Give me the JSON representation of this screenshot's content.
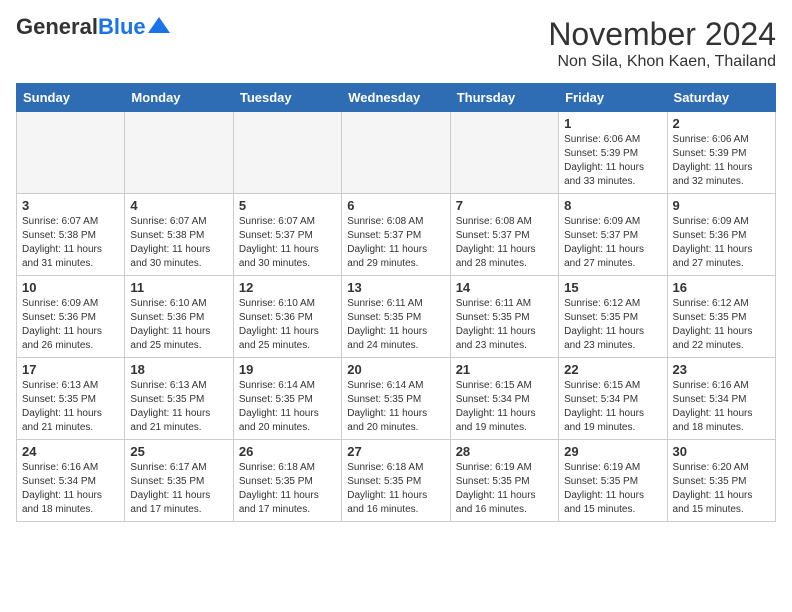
{
  "header": {
    "logo_general": "General",
    "logo_blue": "Blue",
    "month_title": "November 2024",
    "location": "Non Sila, Khon Kaen, Thailand"
  },
  "days_of_week": [
    "Sunday",
    "Monday",
    "Tuesday",
    "Wednesday",
    "Thursday",
    "Friday",
    "Saturday"
  ],
  "weeks": [
    [
      {
        "day": "",
        "info": ""
      },
      {
        "day": "",
        "info": ""
      },
      {
        "day": "",
        "info": ""
      },
      {
        "day": "",
        "info": ""
      },
      {
        "day": "",
        "info": ""
      },
      {
        "day": "1",
        "info": "Sunrise: 6:06 AM\nSunset: 5:39 PM\nDaylight: 11 hours and 33 minutes."
      },
      {
        "day": "2",
        "info": "Sunrise: 6:06 AM\nSunset: 5:39 PM\nDaylight: 11 hours and 32 minutes."
      }
    ],
    [
      {
        "day": "3",
        "info": "Sunrise: 6:07 AM\nSunset: 5:38 PM\nDaylight: 11 hours and 31 minutes."
      },
      {
        "day": "4",
        "info": "Sunrise: 6:07 AM\nSunset: 5:38 PM\nDaylight: 11 hours and 30 minutes."
      },
      {
        "day": "5",
        "info": "Sunrise: 6:07 AM\nSunset: 5:37 PM\nDaylight: 11 hours and 30 minutes."
      },
      {
        "day": "6",
        "info": "Sunrise: 6:08 AM\nSunset: 5:37 PM\nDaylight: 11 hours and 29 minutes."
      },
      {
        "day": "7",
        "info": "Sunrise: 6:08 AM\nSunset: 5:37 PM\nDaylight: 11 hours and 28 minutes."
      },
      {
        "day": "8",
        "info": "Sunrise: 6:09 AM\nSunset: 5:37 PM\nDaylight: 11 hours and 27 minutes."
      },
      {
        "day": "9",
        "info": "Sunrise: 6:09 AM\nSunset: 5:36 PM\nDaylight: 11 hours and 27 minutes."
      }
    ],
    [
      {
        "day": "10",
        "info": "Sunrise: 6:09 AM\nSunset: 5:36 PM\nDaylight: 11 hours and 26 minutes."
      },
      {
        "day": "11",
        "info": "Sunrise: 6:10 AM\nSunset: 5:36 PM\nDaylight: 11 hours and 25 minutes."
      },
      {
        "day": "12",
        "info": "Sunrise: 6:10 AM\nSunset: 5:36 PM\nDaylight: 11 hours and 25 minutes."
      },
      {
        "day": "13",
        "info": "Sunrise: 6:11 AM\nSunset: 5:35 PM\nDaylight: 11 hours and 24 minutes."
      },
      {
        "day": "14",
        "info": "Sunrise: 6:11 AM\nSunset: 5:35 PM\nDaylight: 11 hours and 23 minutes."
      },
      {
        "day": "15",
        "info": "Sunrise: 6:12 AM\nSunset: 5:35 PM\nDaylight: 11 hours and 23 minutes."
      },
      {
        "day": "16",
        "info": "Sunrise: 6:12 AM\nSunset: 5:35 PM\nDaylight: 11 hours and 22 minutes."
      }
    ],
    [
      {
        "day": "17",
        "info": "Sunrise: 6:13 AM\nSunset: 5:35 PM\nDaylight: 11 hours and 21 minutes."
      },
      {
        "day": "18",
        "info": "Sunrise: 6:13 AM\nSunset: 5:35 PM\nDaylight: 11 hours and 21 minutes."
      },
      {
        "day": "19",
        "info": "Sunrise: 6:14 AM\nSunset: 5:35 PM\nDaylight: 11 hours and 20 minutes."
      },
      {
        "day": "20",
        "info": "Sunrise: 6:14 AM\nSunset: 5:35 PM\nDaylight: 11 hours and 20 minutes."
      },
      {
        "day": "21",
        "info": "Sunrise: 6:15 AM\nSunset: 5:34 PM\nDaylight: 11 hours and 19 minutes."
      },
      {
        "day": "22",
        "info": "Sunrise: 6:15 AM\nSunset: 5:34 PM\nDaylight: 11 hours and 19 minutes."
      },
      {
        "day": "23",
        "info": "Sunrise: 6:16 AM\nSunset: 5:34 PM\nDaylight: 11 hours and 18 minutes."
      }
    ],
    [
      {
        "day": "24",
        "info": "Sunrise: 6:16 AM\nSunset: 5:34 PM\nDaylight: 11 hours and 18 minutes."
      },
      {
        "day": "25",
        "info": "Sunrise: 6:17 AM\nSunset: 5:35 PM\nDaylight: 11 hours and 17 minutes."
      },
      {
        "day": "26",
        "info": "Sunrise: 6:18 AM\nSunset: 5:35 PM\nDaylight: 11 hours and 17 minutes."
      },
      {
        "day": "27",
        "info": "Sunrise: 6:18 AM\nSunset: 5:35 PM\nDaylight: 11 hours and 16 minutes."
      },
      {
        "day": "28",
        "info": "Sunrise: 6:19 AM\nSunset: 5:35 PM\nDaylight: 11 hours and 16 minutes."
      },
      {
        "day": "29",
        "info": "Sunrise: 6:19 AM\nSunset: 5:35 PM\nDaylight: 11 hours and 15 minutes."
      },
      {
        "day": "30",
        "info": "Sunrise: 6:20 AM\nSunset: 5:35 PM\nDaylight: 11 hours and 15 minutes."
      }
    ]
  ]
}
